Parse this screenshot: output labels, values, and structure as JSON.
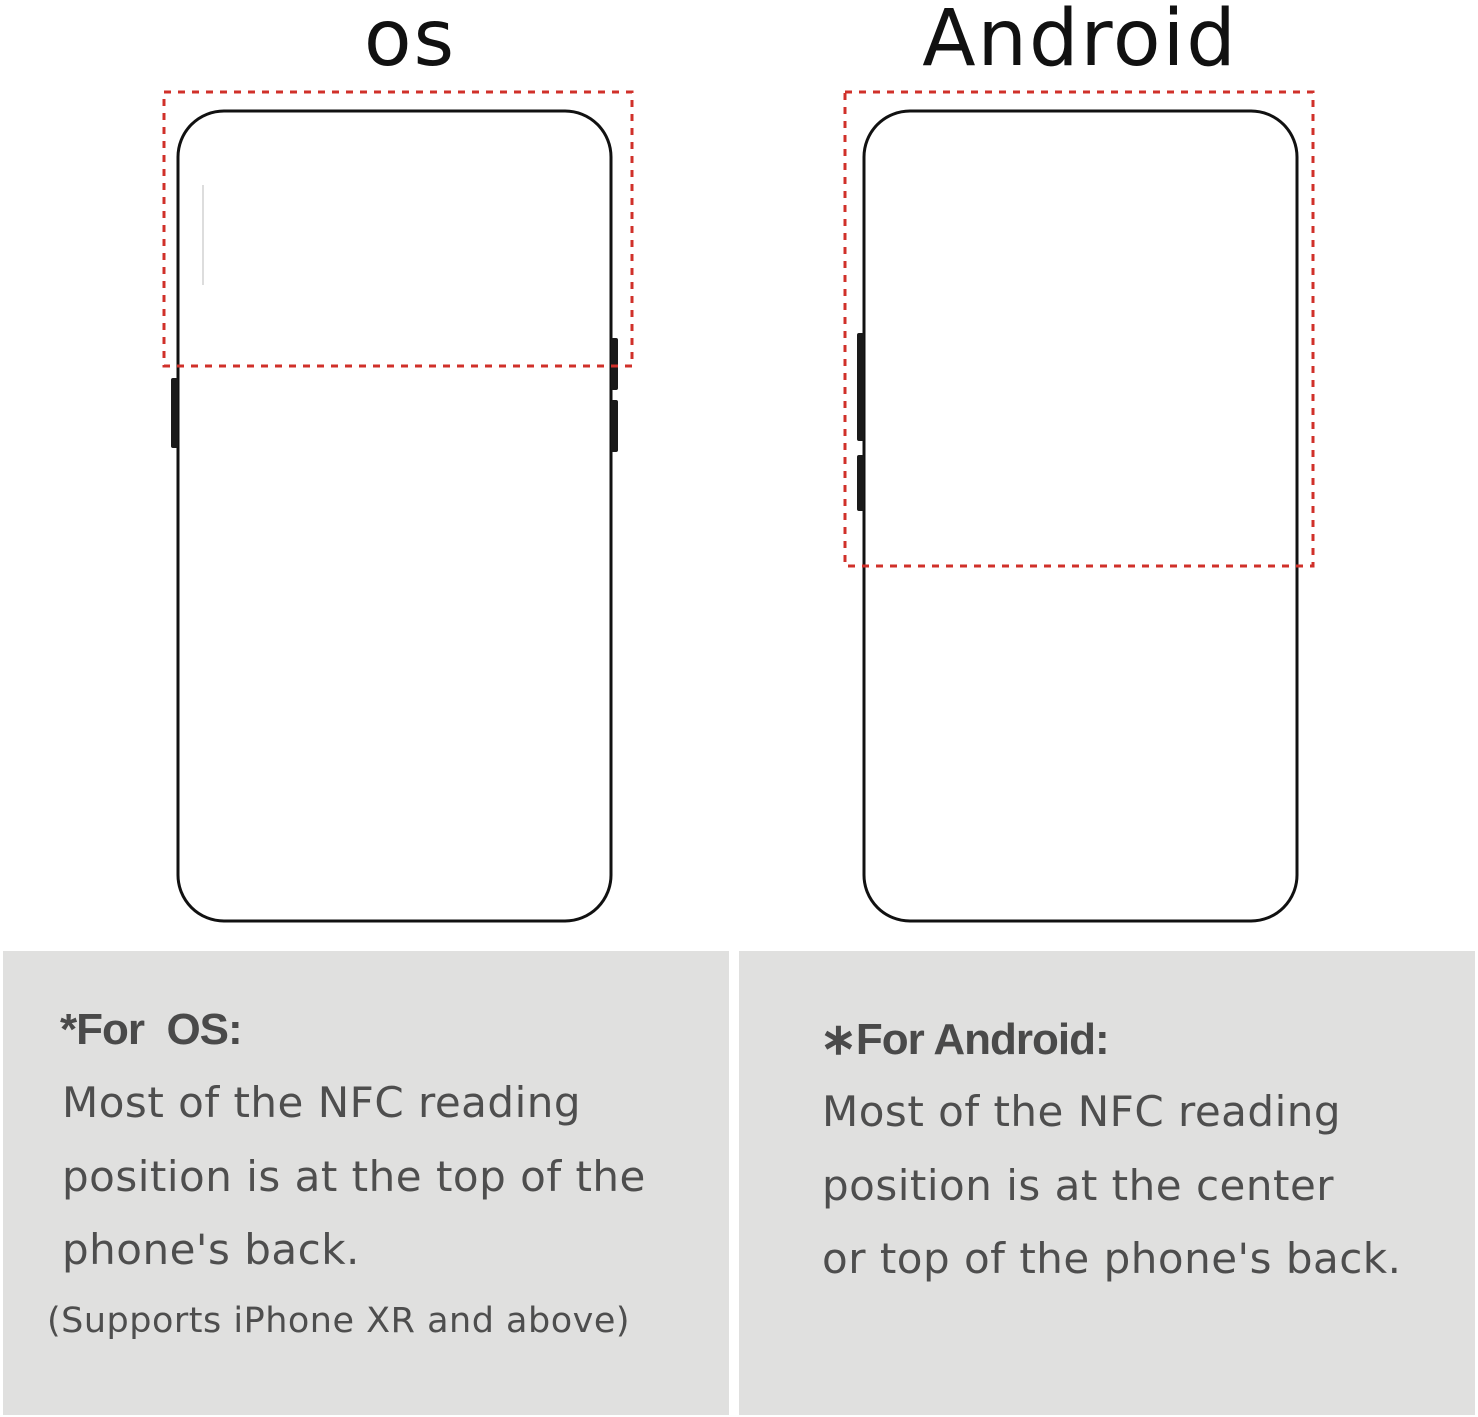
{
  "titles": {
    "ios": "os",
    "android": "Android"
  },
  "colors": {
    "reading_zone": "#d0302a",
    "phone_outline": "#111111",
    "panel_background": "#e0e0df",
    "panel_text": "#4e4e4e"
  },
  "panels": {
    "ios": {
      "heading": "*For  OS:",
      "lines": [
        "Most of the NFC reading",
        "position is at the top of the",
        "phone's back."
      ],
      "note": "(Supports iPhone XR and above)"
    },
    "android": {
      "heading": "∗For Android:",
      "lines": [
        "Most of the NFC reading",
        "position is at the center",
        "or top of the phone's back."
      ]
    }
  }
}
